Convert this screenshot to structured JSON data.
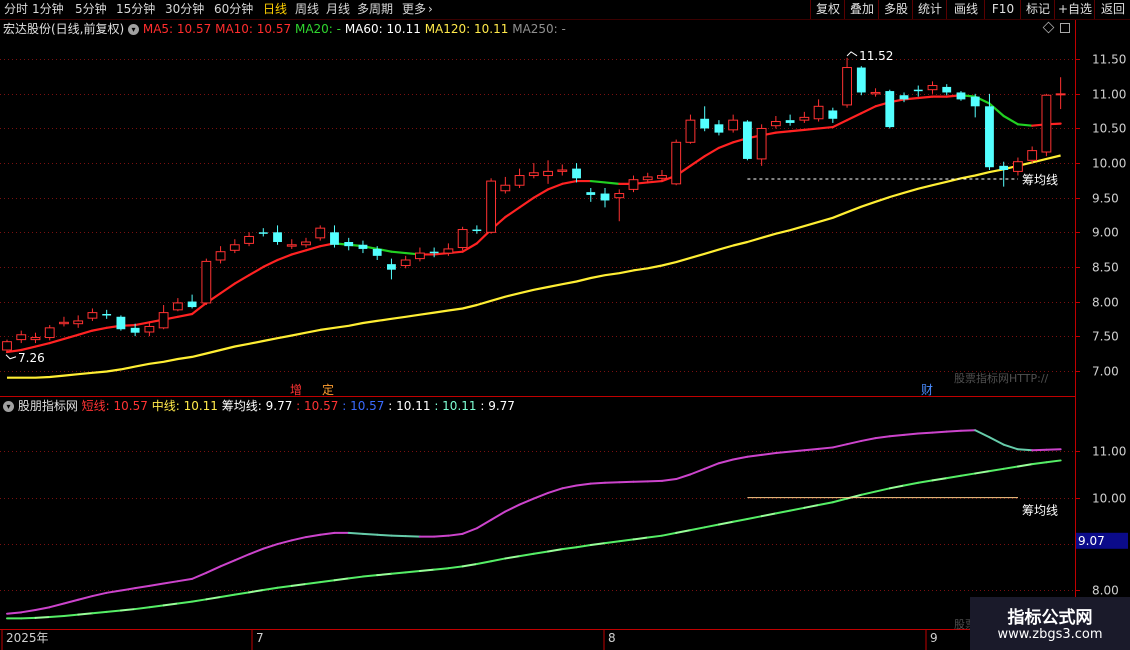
{
  "toolbar": {
    "periods": [
      "分时",
      "1分钟",
      "5分钟",
      "15分钟",
      "30分钟",
      "60分钟",
      "日线",
      "周线",
      "月线",
      "多周期",
      "更多"
    ],
    "active_period": "日线",
    "more_arrow": "›",
    "buttons": [
      "复权",
      "叠加",
      "多股",
      "统计",
      "画线",
      "F10",
      "标记",
      "+自选",
      "返回"
    ]
  },
  "main_panel": {
    "stock_title": "宏达股份(日线,前复权)",
    "ma": [
      {
        "label": "MA5: 10.57",
        "color": "#ff2d2d"
      },
      {
        "label": "MA10: 10.57",
        "color": "#ff2d2d"
      },
      {
        "label": "MA20: -",
        "color": "#2fd52f"
      },
      {
        "label": "MA60: 10.11",
        "color": "#ffffff"
      },
      {
        "label": "MA120: 10.11",
        "color": "#ffe94a"
      },
      {
        "label": "MA250: -",
        "color": "#909090"
      }
    ],
    "high_label": "11.52",
    "low_label": "7.26",
    "chip_label": "筹均线",
    "event_tags": [
      {
        "text": "增",
        "color": "#ff3333"
      },
      {
        "text": "定",
        "color": "#ff9e30"
      },
      {
        "text": "财",
        "color": "#4a8cff"
      }
    ],
    "watermark": "股票指标网HTTP://",
    "corner_icons": [
      "diamond-icon",
      "square-icon"
    ]
  },
  "sub_panel": {
    "name": "股朋指标网",
    "items": [
      {
        "label": "短线: 10.57",
        "color": "#ff3333"
      },
      {
        "label": "中线: 10.11",
        "color": "#ffe94a"
      },
      {
        "label": "筹均线: 9.77",
        "color": "#ffffff"
      },
      {
        "label": ": 10.57",
        "color": "#ff3333"
      },
      {
        "label": ": 10.57",
        "color": "#3a6bff"
      },
      {
        "label": ": 10.11",
        "color": "#ffffff"
      },
      {
        "label": ": 10.11",
        "color": "#7fffd4"
      },
      {
        "label": ": 9.77",
        "color": "#ffffff"
      }
    ],
    "chip_label": "筹均线",
    "value_box": "9.07",
    "watermark": "股票"
  },
  "x_axis": [
    "2025年",
    "7",
    "8",
    "9"
  ],
  "brand": {
    "name": "指标公式网",
    "url": "www.zbgs3.com"
  },
  "chart_data": {
    "type": "candlestick",
    "main_y_ticks": [
      11.5,
      11.0,
      10.5,
      10.0,
      9.5,
      9.0,
      8.5,
      8.0,
      7.5,
      7.0
    ],
    "main_ylim": [
      6.65,
      11.85
    ],
    "sub_y_ticks": [
      11.0,
      10.0,
      9.0,
      8.0
    ],
    "sub_ylim": [
      7.3,
      11.8
    ],
    "candles": [
      [
        7.3,
        7.42,
        7.45,
        7.26
      ],
      [
        7.45,
        7.52,
        7.58,
        7.4
      ],
      [
        7.45,
        7.48,
        7.55,
        7.4
      ],
      [
        7.48,
        7.62,
        7.66,
        7.44
      ],
      [
        7.68,
        7.7,
        7.78,
        7.64
      ],
      [
        7.68,
        7.72,
        7.8,
        7.62
      ],
      [
        7.76,
        7.84,
        7.9,
        7.72
      ],
      [
        7.82,
        7.8,
        7.88,
        7.75
      ],
      [
        7.78,
        7.6,
        7.8,
        7.58
      ],
      [
        7.62,
        7.55,
        7.68,
        7.5
      ],
      [
        7.56,
        7.64,
        7.7,
        7.5
      ],
      [
        7.62,
        7.84,
        7.95,
        7.6
      ],
      [
        7.88,
        7.98,
        8.05,
        7.86
      ],
      [
        8.0,
        7.92,
        8.1,
        7.9
      ],
      [
        7.98,
        8.58,
        8.62,
        7.95
      ],
      [
        8.6,
        8.72,
        8.8,
        8.55
      ],
      [
        8.74,
        8.82,
        8.9,
        8.7
      ],
      [
        8.84,
        8.94,
        9.0,
        8.8
      ],
      [
        9.0,
        8.98,
        9.06,
        8.94
      ],
      [
        9.0,
        8.86,
        9.1,
        8.82
      ],
      [
        8.8,
        8.82,
        8.9,
        8.76
      ],
      [
        8.82,
        8.86,
        8.92,
        8.78
      ],
      [
        8.92,
        9.06,
        9.1,
        8.88
      ],
      [
        9.0,
        8.82,
        9.1,
        8.78
      ],
      [
        8.86,
        8.8,
        8.92,
        8.74
      ],
      [
        8.82,
        8.76,
        8.88,
        8.7
      ],
      [
        8.76,
        8.66,
        8.8,
        8.6
      ],
      [
        8.54,
        8.46,
        8.62,
        8.32
      ],
      [
        8.52,
        8.6,
        8.66,
        8.48
      ],
      [
        8.62,
        8.7,
        8.78,
        8.58
      ],
      [
        8.72,
        8.7,
        8.78,
        8.64
      ],
      [
        8.7,
        8.76,
        8.84,
        8.66
      ],
      [
        8.78,
        9.04,
        9.08,
        8.74
      ],
      [
        9.04,
        9.02,
        9.1,
        8.98
      ],
      [
        9.0,
        9.74,
        9.78,
        8.98
      ],
      [
        9.6,
        9.68,
        9.8,
        9.56
      ],
      [
        9.68,
        9.82,
        9.92,
        9.64
      ],
      [
        9.82,
        9.86,
        10.0,
        9.78
      ],
      [
        9.82,
        9.88,
        10.04,
        9.7
      ],
      [
        9.88,
        9.9,
        9.98,
        9.82
      ],
      [
        9.92,
        9.78,
        10.0,
        9.72
      ],
      [
        9.58,
        9.54,
        9.64,
        9.44
      ],
      [
        9.56,
        9.46,
        9.64,
        9.36
      ],
      [
        9.5,
        9.56,
        9.62,
        9.16
      ],
      [
        9.62,
        9.76,
        9.82,
        9.58
      ],
      [
        9.76,
        9.8,
        9.86,
        9.72
      ],
      [
        9.78,
        9.82,
        9.9,
        9.74
      ],
      [
        9.7,
        10.3,
        10.34,
        9.68
      ],
      [
        10.3,
        10.62,
        10.7,
        10.28
      ],
      [
        10.64,
        10.5,
        10.82,
        10.46
      ],
      [
        10.56,
        10.44,
        10.62,
        10.4
      ],
      [
        10.48,
        10.62,
        10.7,
        10.44
      ],
      [
        10.6,
        10.06,
        10.62,
        10.04
      ],
      [
        10.06,
        10.5,
        10.56,
        9.96
      ],
      [
        10.54,
        10.6,
        10.68,
        10.5
      ],
      [
        10.62,
        10.58,
        10.7,
        10.54
      ],
      [
        10.62,
        10.66,
        10.74,
        10.58
      ],
      [
        10.64,
        10.82,
        10.92,
        10.6
      ],
      [
        10.76,
        10.64,
        10.8,
        10.58
      ],
      [
        10.84,
        11.38,
        11.52,
        10.8
      ],
      [
        11.38,
        11.02,
        11.4,
        10.98
      ],
      [
        11.0,
        11.02,
        11.08,
        10.96
      ],
      [
        11.04,
        10.52,
        11.06,
        10.5
      ],
      [
        10.98,
        10.92,
        11.02,
        10.88
      ],
      [
        11.06,
        11.04,
        11.12,
        10.96
      ],
      [
        11.06,
        11.12,
        11.18,
        11.0
      ],
      [
        11.1,
        11.02,
        11.14,
        10.98
      ],
      [
        11.02,
        10.92,
        11.04,
        10.9
      ],
      [
        10.96,
        10.82,
        11.0,
        10.66
      ],
      [
        10.82,
        9.94,
        11.0,
        9.9
      ],
      [
        9.96,
        9.9,
        10.02,
        9.66
      ],
      [
        9.88,
        10.02,
        10.08,
        9.82
      ],
      [
        10.04,
        10.18,
        10.24,
        10.0
      ],
      [
        10.16,
        10.98,
        11.0,
        10.1
      ],
      [
        11.0,
        11.0,
        11.24,
        10.78
      ]
    ],
    "short_line": [
      7.27,
      7.3,
      7.35,
      7.4,
      7.46,
      7.52,
      7.58,
      7.62,
      7.65,
      7.66,
      7.7,
      7.74,
      7.78,
      7.82,
      7.98,
      8.12,
      8.26,
      8.38,
      8.5,
      8.6,
      8.68,
      8.74,
      8.8,
      8.84,
      8.82,
      8.8,
      8.76,
      8.72,
      8.7,
      8.68,
      8.68,
      8.7,
      8.72,
      8.84,
      9.04,
      9.22,
      9.36,
      9.5,
      9.62,
      9.7,
      9.74,
      9.74,
      9.72,
      9.7,
      9.7,
      9.72,
      9.74,
      9.82,
      9.96,
      10.1,
      10.22,
      10.3,
      10.36,
      10.4,
      10.44,
      10.46,
      10.48,
      10.5,
      10.52,
      10.62,
      10.72,
      10.82,
      10.88,
      10.92,
      10.94,
      10.96,
      10.96,
      10.98,
      10.96,
      10.86,
      10.68,
      10.56,
      10.54,
      10.56,
      10.57
    ],
    "mid_line": [
      6.9,
      6.9,
      6.9,
      6.91,
      6.93,
      6.95,
      6.97,
      6.99,
      7.02,
      7.06,
      7.1,
      7.13,
      7.17,
      7.2,
      7.25,
      7.3,
      7.35,
      7.39,
      7.43,
      7.47,
      7.51,
      7.55,
      7.59,
      7.62,
      7.65,
      7.69,
      7.72,
      7.75,
      7.78,
      7.81,
      7.84,
      7.87,
      7.9,
      7.95,
      8.01,
      8.07,
      8.12,
      8.17,
      8.21,
      8.25,
      8.29,
      8.34,
      8.38,
      8.41,
      8.45,
      8.48,
      8.52,
      8.57,
      8.63,
      8.69,
      8.75,
      8.81,
      8.86,
      8.92,
      8.98,
      9.03,
      9.09,
      9.15,
      9.21,
      9.29,
      9.37,
      9.44,
      9.51,
      9.57,
      9.63,
      9.68,
      9.73,
      9.78,
      9.82,
      9.87,
      9.91,
      9.96,
      10.01,
      10.06,
      10.11
    ],
    "chip_avg": 9.77,
    "ma5_current": 10.57,
    "ma60_current": 10.11,
    "sub_short_line": [
      7.5,
      7.53,
      7.58,
      7.64,
      7.72,
      7.8,
      7.88,
      7.95,
      8.0,
      8.05,
      8.1,
      8.15,
      8.2,
      8.25,
      8.38,
      8.52,
      8.65,
      8.78,
      8.9,
      9.0,
      9.08,
      9.15,
      9.2,
      9.24,
      9.24,
      9.22,
      9.2,
      9.18,
      9.17,
      9.16,
      9.16,
      9.18,
      9.22,
      9.34,
      9.52,
      9.7,
      9.85,
      9.98,
      10.1,
      10.2,
      10.26,
      10.3,
      10.32,
      10.33,
      10.34,
      10.35,
      10.36,
      10.4,
      10.5,
      10.62,
      10.74,
      10.82,
      10.88,
      10.92,
      10.96,
      10.99,
      11.02,
      11.05,
      11.08,
      11.15,
      11.22,
      11.28,
      11.32,
      11.35,
      11.38,
      11.4,
      11.42,
      11.44,
      11.45,
      11.3,
      11.14,
      11.04,
      11.02,
      11.03,
      11.04
    ],
    "sub_mid_line": [
      7.4,
      7.4,
      7.41,
      7.43,
      7.45,
      7.48,
      7.51,
      7.54,
      7.57,
      7.6,
      7.64,
      7.68,
      7.72,
      7.76,
      7.81,
      7.86,
      7.91,
      7.96,
      8.01,
      8.06,
      8.1,
      8.14,
      8.18,
      8.22,
      8.26,
      8.3,
      8.33,
      8.36,
      8.39,
      8.42,
      8.45,
      8.48,
      8.52,
      8.57,
      8.63,
      8.69,
      8.74,
      8.79,
      8.84,
      8.89,
      8.93,
      8.98,
      9.02,
      9.06,
      9.1,
      9.14,
      9.18,
      9.24,
      9.3,
      9.36,
      9.42,
      9.48,
      9.54,
      9.6,
      9.66,
      9.72,
      9.78,
      9.84,
      9.9,
      9.98,
      10.06,
      10.13,
      10.2,
      10.26,
      10.32,
      10.37,
      10.42,
      10.47,
      10.52,
      10.57,
      10.62,
      10.67,
      10.72,
      10.76,
      10.8
    ]
  }
}
